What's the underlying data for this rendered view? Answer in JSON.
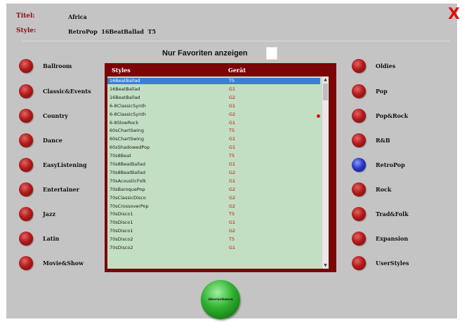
{
  "header": {
    "title_label": "Titel:",
    "title_value": "Africa",
    "style_label": "Style:",
    "style_value": "RetroPop  16BeatBallad  T5",
    "close_glyph": "X"
  },
  "favorites": {
    "label": "Nur Favoriten anzeigen",
    "checked": false
  },
  "left_categories": [
    {
      "label": "Ballroom"
    },
    {
      "label": "Classic&Events"
    },
    {
      "label": "Country"
    },
    {
      "label": "Dance"
    },
    {
      "label": "EasyListening"
    },
    {
      "label": "Entertainer"
    },
    {
      "label": "Jazz"
    },
    {
      "label": "Latin"
    },
    {
      "label": "Movie&Show"
    }
  ],
  "right_categories": [
    {
      "label": "Oldies"
    },
    {
      "label": "Pop"
    },
    {
      "label": "Pop&Rock"
    },
    {
      "label": "R&B"
    },
    {
      "label": "RetroPop"
    },
    {
      "label": "Rock"
    },
    {
      "label": "Trad&Folk"
    },
    {
      "label": "Expansion"
    },
    {
      "label": "UserStyles"
    }
  ],
  "selected_category": "RetroPop",
  "styles_list": {
    "col_styles": "Styles",
    "col_geraet": "Gerät",
    "selected_index": 0,
    "rows": [
      {
        "name": "16BeatBallad",
        "device": "T5"
      },
      {
        "name": "16BeatBallad",
        "device": "G1"
      },
      {
        "name": "16BeatBallad",
        "device": "G2"
      },
      {
        "name": "6-8ClassicSynth",
        "device": "G1"
      },
      {
        "name": "6-8ClassicSynth",
        "device": "G2"
      },
      {
        "name": "6-8SlowRock",
        "device": "G1"
      },
      {
        "name": "60sChartSwing",
        "device": "T5"
      },
      {
        "name": "60sChartSwing",
        "device": "G1"
      },
      {
        "name": "60sShadowedPop",
        "device": "G1"
      },
      {
        "name": "70s8Beat",
        "device": "T5"
      },
      {
        "name": "70s8BeatBallad",
        "device": "G1"
      },
      {
        "name": "70s8BeatBallad",
        "device": "G2"
      },
      {
        "name": "70sAcousticFolk",
        "device": "G1"
      },
      {
        "name": "70sBaroquePop",
        "device": "G2"
      },
      {
        "name": "70sClassicDisco",
        "device": "G2"
      },
      {
        "name": "70sCrossoverPop",
        "device": "G2"
      },
      {
        "name": "70sDisco1",
        "device": "T5"
      },
      {
        "name": "70sDisco1",
        "device": "G1"
      },
      {
        "name": "70sDisco1",
        "device": "G2"
      },
      {
        "name": "70sDisco2",
        "device": "T5"
      },
      {
        "name": "70sDisco2",
        "device": "G1"
      }
    ]
  },
  "apply_button": {
    "label": "übernehmen"
  },
  "colors": {
    "panel": "#7a0606",
    "list_bg": "#c3dfc3",
    "selection": "#3a7fd5",
    "device_text": "#c01010",
    "accent_red": "#8c1010",
    "close": "#e01010"
  }
}
